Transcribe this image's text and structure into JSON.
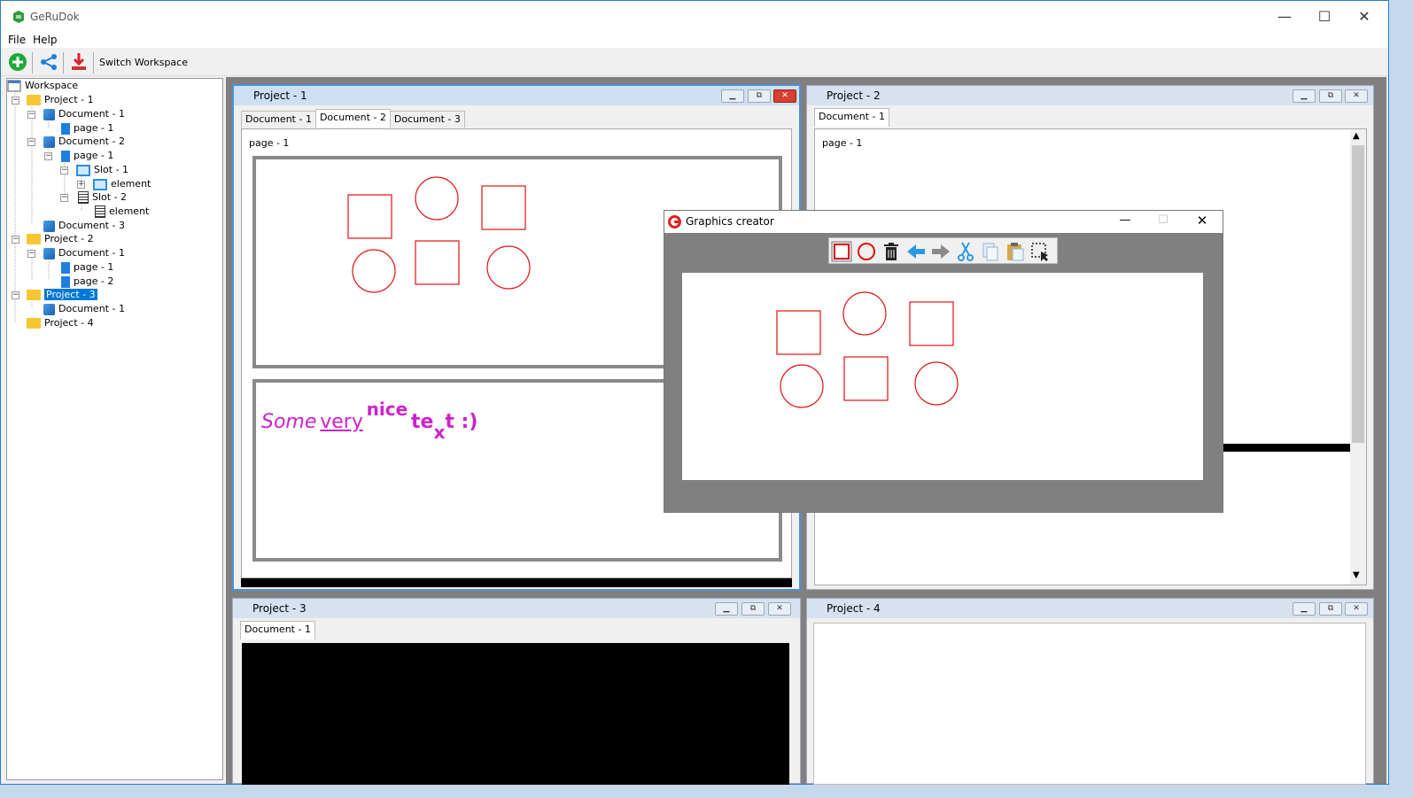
{
  "app": {
    "title": "GeRuDok",
    "minimize": "—",
    "maximize": "☐",
    "close": "✕"
  },
  "menu": {
    "file": "File",
    "help": "Help"
  },
  "toolbar": {
    "switch_workspace": "Switch Workspace"
  },
  "tree": {
    "root": "Workspace",
    "p1": "Project - 1",
    "p1d1": "Document - 1",
    "p1d1pg1": "page - 1",
    "p1d2": "Document - 2",
    "p1d2pg1": "page - 1",
    "slot1": "Slot - 1",
    "slot1el": "element",
    "slot2": "Slot - 2",
    "slot2el": "element",
    "p1d3": "Document - 3",
    "p2": "Project - 2",
    "p2d1": "Document - 1",
    "p2d1pg1": "page - 1",
    "p2d1pg2": "page - 2",
    "p3": "Project - 3",
    "p3d1": "Document - 1",
    "p4": "Project - 4"
  },
  "frames": {
    "f1": {
      "title": "Project - 1",
      "tabs": [
        "Document - 1",
        "Document - 2",
        "Document - 3"
      ],
      "page": "page - 1"
    },
    "f2": {
      "title": "Project - 2",
      "tabs": [
        "Document - 1"
      ],
      "page": "page - 1"
    },
    "f3": {
      "title": "Project - 3",
      "tabs": [
        "Document - 1"
      ]
    },
    "f4": {
      "title": "Project - 4"
    }
  },
  "richtext": {
    "some": "Some",
    "very": "very",
    "nice": "nice",
    "te": "te",
    "x": "x",
    "t": "t :)"
  },
  "dialog": {
    "title": "Graphics creator",
    "minimize": "—",
    "maximize": "☐",
    "close": "✕"
  },
  "colors": {
    "shape": "#e01010",
    "richtext": "#cc22cc",
    "selection": "#0078d7"
  }
}
